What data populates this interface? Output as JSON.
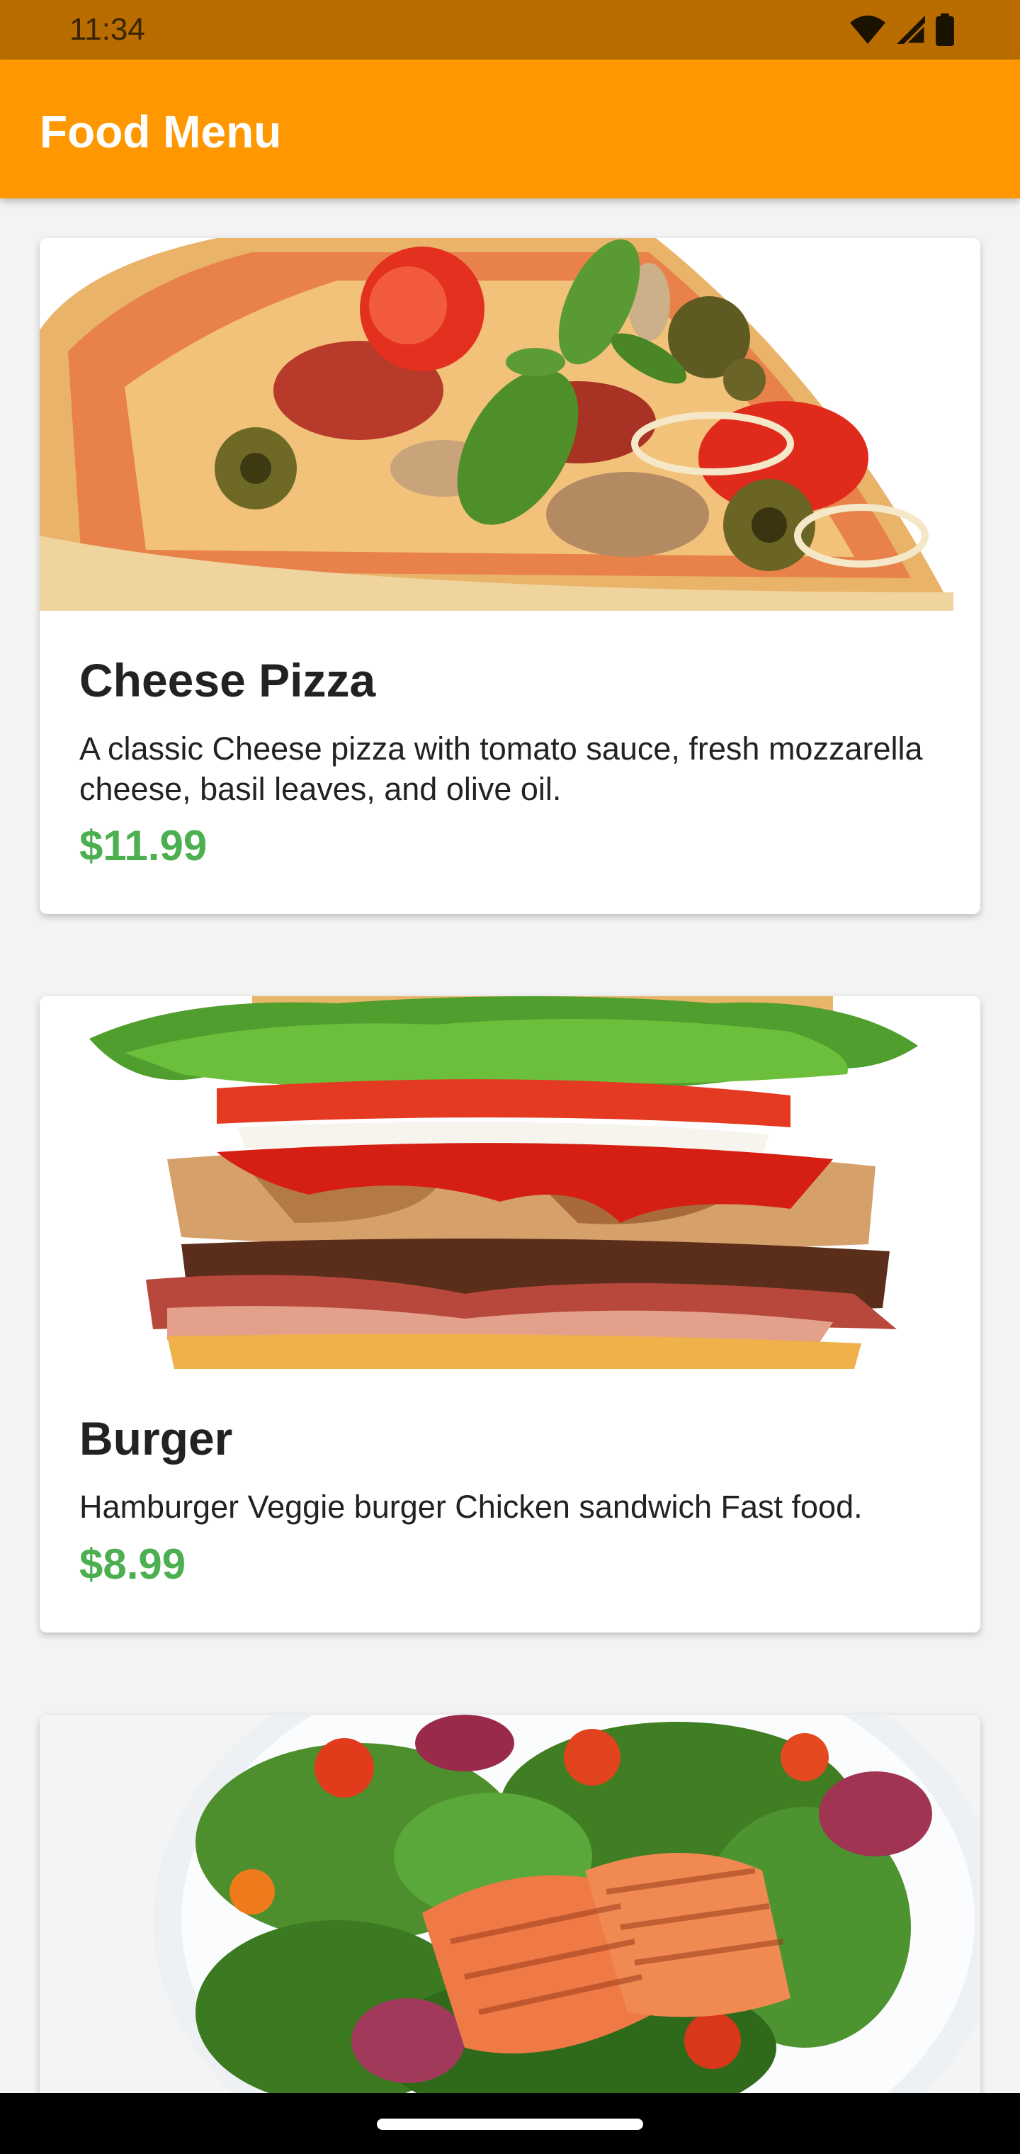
{
  "status_bar": {
    "time": "11:34",
    "icons": [
      "wifi-icon",
      "cell-signal-icon",
      "battery-icon"
    ]
  },
  "app_bar": {
    "title": "Food Menu",
    "color": "#ff9800"
  },
  "menu": {
    "items": [
      {
        "name": "Cheese Pizza",
        "description": "A classic Cheese pizza with tomato sauce, fresh mozzarella cheese, basil leaves, and olive oil.",
        "price": "$11.99",
        "image": "pizza-image"
      },
      {
        "name": "Burger",
        "description": "Hamburger Veggie burger Chicken sandwich Fast food.",
        "price": "$8.99",
        "image": "burger-image"
      },
      {
        "name": "",
        "description": "",
        "price": "",
        "image": "salmon-salad-image"
      }
    ]
  },
  "colors": {
    "price": "#4caf50",
    "status_bar": "#b96d00"
  }
}
